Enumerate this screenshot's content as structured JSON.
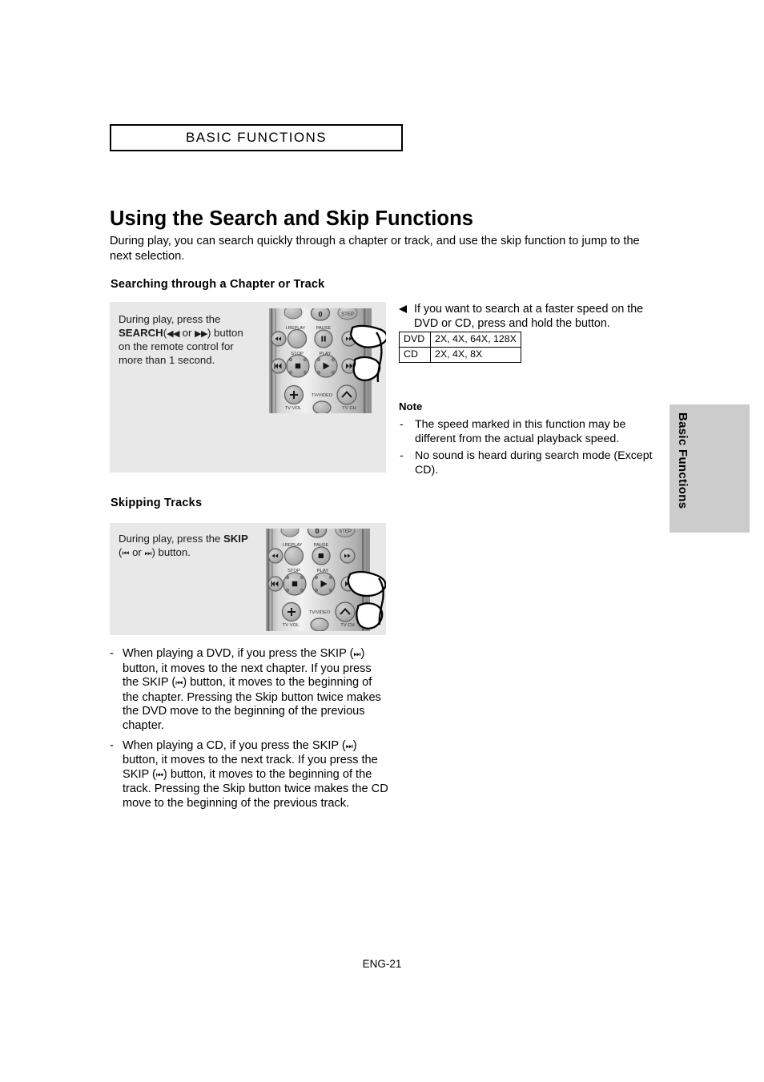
{
  "chapter": {
    "title": "BASIC FUNCTIONS"
  },
  "page": {
    "title": "Using the Search and Skip Functions",
    "intro": "During play, you can search quickly through a chapter or track, and use the skip function to jump to the next selection.",
    "footer": "ENG-21"
  },
  "sections": {
    "search": {
      "heading": "Searching through a Chapter or Track",
      "panel_text_line1": "During play,  press the",
      "panel_text_bold": "SEARCH",
      "panel_text_glyph_open": "(",
      "panel_text_rew": "◀◀",
      "panel_text_or": " or ",
      "panel_text_ff": "▶▶",
      "panel_text_glyph_close": ") button",
      "panel_text_line3": "on the remote control for",
      "panel_text_line4": "more than 1 second."
    },
    "skip": {
      "heading": "Skipping Tracks",
      "panel_text_prefix": "During play, press the ",
      "panel_text_bold": "SKIP",
      "panel_text_glyph_open": "(",
      "panel_text_prev": "⏮",
      "panel_text_or": "  or  ",
      "panel_text_next": "⏭",
      "panel_text_suffix": ") button."
    }
  },
  "callout": {
    "text": "If you want to search at a faster speed on the DVD or CD, press and hold the button.",
    "arrow_icon": "arrow-left-icon"
  },
  "speed_table": {
    "rows": [
      {
        "media": "DVD",
        "speeds": "2X, 4X, 64X, 128X"
      },
      {
        "media": "CD",
        "speeds": "2X, 4X, 8X"
      }
    ]
  },
  "note": {
    "title": "Note",
    "items": [
      "The speed marked in this function may be different from the actual playback speed.",
      "No sound is heard during search mode (Except CD)."
    ],
    "dash": "-"
  },
  "skip_notes": {
    "dash": "-",
    "items": [
      {
        "part1": "When playing a DVD, if you press the SKIP (",
        "glyph1": "⏭",
        "part2": ") button, it moves to the next chapter. If you press the SKIP (",
        "glyph2": "⏮",
        "part3": ") button, it moves to the beginning of the chapter. Pressing the Skip button twice makes the DVD move to the beginning of the previous chapter."
      },
      {
        "part1": "When playing a CD, if you press the SKIP (",
        "glyph1": "⏭",
        "part2": ") button, it moves to the next track. If you press the SKIP (",
        "glyph2": "⏮",
        "part3": ") button, it moves to the beginning of the track. Pressing the Skip button twice makes the CD move to the beginning of the previous track."
      }
    ]
  },
  "side_tab": {
    "label": "Basic Functions",
    "color": "#cccccc"
  },
  "remote": {
    "labels": {
      "zero": "0",
      "step": "STEP",
      "replay": "I.REPLAY",
      "pause": "PAUSE",
      "stop": "STOP",
      "play": "PLAY",
      "tv_vol": "TV VOL",
      "tv_video": "TV/VIDEO",
      "tv_ch": "TV CH",
      "plus": "+"
    }
  },
  "colors": {
    "panel_bg": "#e8e8e8",
    "tab_bg": "#cccccc",
    "remote_body": "#c9c9c9",
    "button_fill": "#b5b5b5",
    "text": "#000000"
  }
}
